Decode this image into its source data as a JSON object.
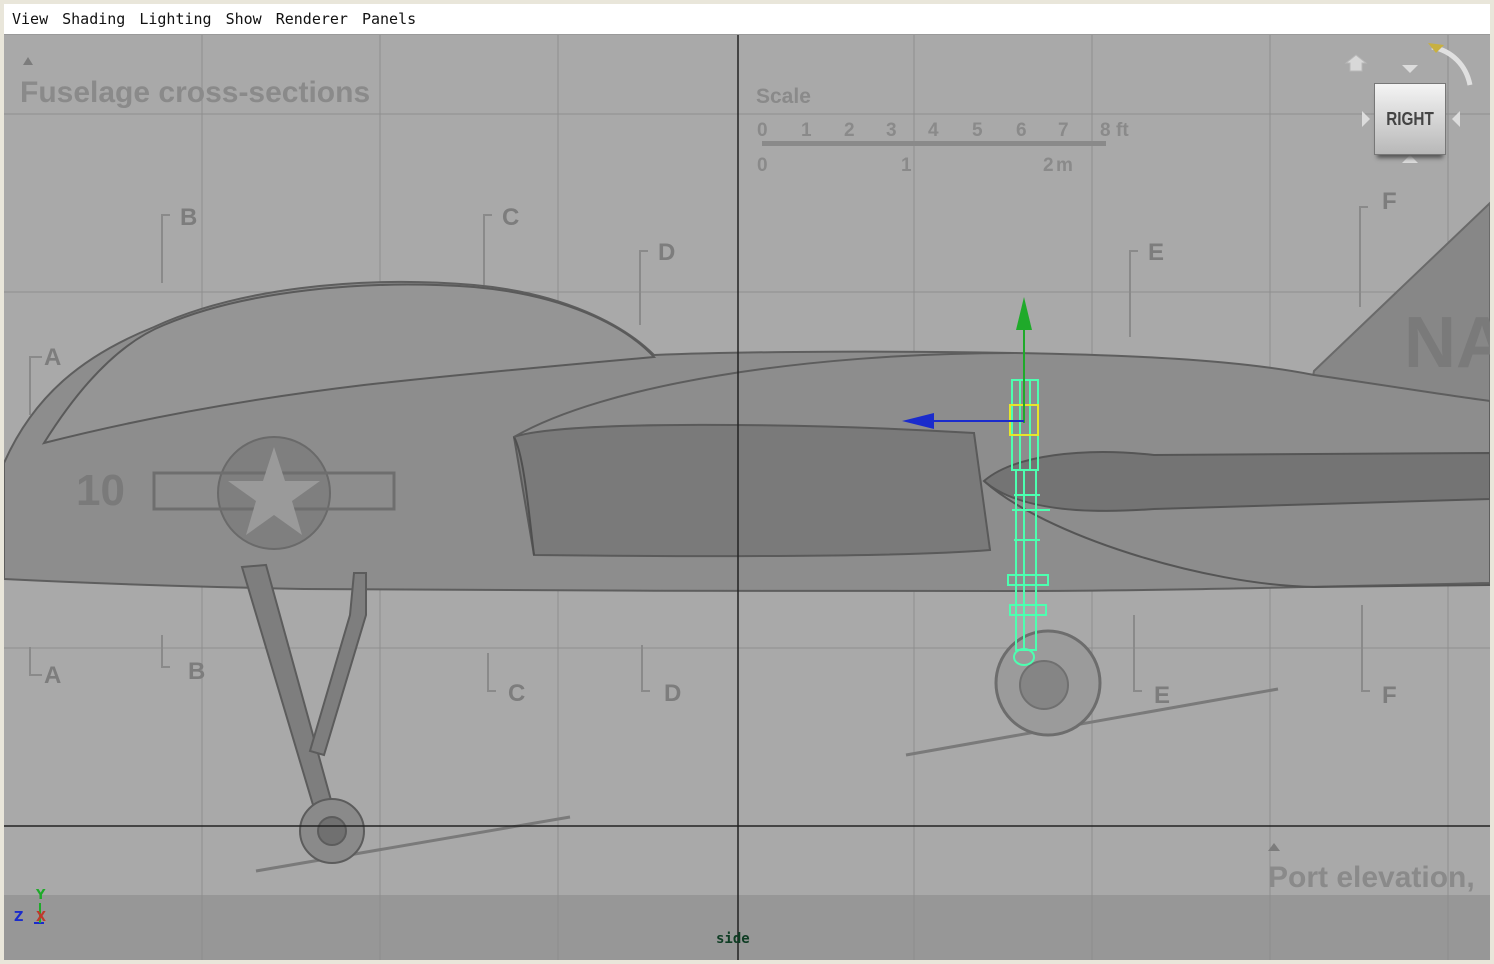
{
  "menubar": {
    "items": [
      "View",
      "Shading",
      "Lighting",
      "Show",
      "Renderer",
      "Panels"
    ]
  },
  "viewport": {
    "camera_label": "side",
    "viewcube_face": "RIGHT",
    "axis_labels": {
      "y": "Y",
      "z": "Z",
      "x": "X"
    },
    "background_color": "#a9a9a9"
  },
  "blueprint": {
    "title": "Fuselage cross-sections",
    "scale_title": "Scale",
    "scale_ft_ticks": [
      "0",
      "1",
      "2",
      "3",
      "4",
      "5",
      "6",
      "7",
      "8"
    ],
    "scale_ft_unit": "ft",
    "scale_m_ticks": [
      "0",
      "1",
      "2"
    ],
    "scale_m_unit": "m",
    "section_letters": [
      "A",
      "B",
      "C",
      "D",
      "E",
      "F"
    ],
    "port_elevation": "Port elevation,",
    "tail_text": "NA"
  },
  "icons": {
    "home": "home-icon",
    "rotate": "rotate-arc-icon"
  },
  "colors": {
    "selection": "#4dffb0",
    "manip_y": "#1faa2a",
    "manip_x": "#1a2bcc",
    "pivot_box": "#e6e62a",
    "grid_major": "#222222"
  }
}
